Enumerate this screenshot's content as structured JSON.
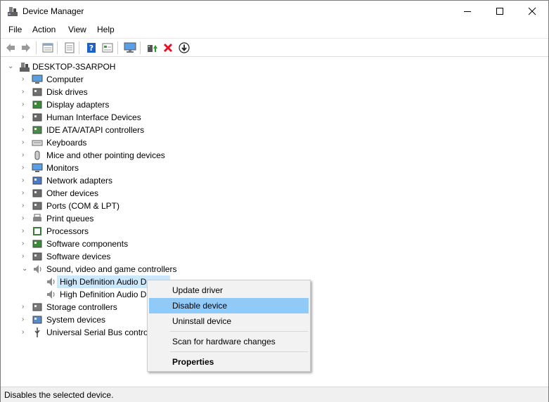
{
  "window": {
    "title": "Device Manager",
    "controls": {
      "minimize": "minimize",
      "maximize": "maximize",
      "close": "close"
    }
  },
  "menu": [
    "File",
    "Action",
    "View",
    "Help"
  ],
  "toolbar": {
    "buttons": [
      "back",
      "forward",
      "properties-pane",
      "view-mode",
      "help",
      "show-hidden",
      "computer-display",
      "update-driver",
      "uninstall",
      "disable"
    ]
  },
  "tree": {
    "root": "DESKTOP-3SARPOH",
    "categories": [
      {
        "label": "Computer",
        "icon": "computer-icon"
      },
      {
        "label": "Disk drives",
        "icon": "disk-drive-icon"
      },
      {
        "label": "Display adapters",
        "icon": "display-adapter-icon"
      },
      {
        "label": "Human Interface Devices",
        "icon": "hid-icon"
      },
      {
        "label": "IDE ATA/ATAPI controllers",
        "icon": "ide-controller-icon"
      },
      {
        "label": "Keyboards",
        "icon": "keyboard-icon"
      },
      {
        "label": "Mice and other pointing devices",
        "icon": "mouse-icon"
      },
      {
        "label": "Monitors",
        "icon": "monitor-icon"
      },
      {
        "label": "Network adapters",
        "icon": "network-adapter-icon"
      },
      {
        "label": "Other devices",
        "icon": "other-devices-icon"
      },
      {
        "label": "Ports (COM & LPT)",
        "icon": "ports-icon"
      },
      {
        "label": "Print queues",
        "icon": "printer-icon"
      },
      {
        "label": "Processors",
        "icon": "processor-icon"
      },
      {
        "label": "Software components",
        "icon": "software-component-icon"
      },
      {
        "label": "Software devices",
        "icon": "software-device-icon"
      },
      {
        "label": "Sound, video and game controllers",
        "icon": "speaker-icon",
        "expanded": true
      }
    ],
    "sound_children": [
      "High Definition Audio De",
      "High Definition Audio D"
    ],
    "after": [
      {
        "label": "Storage controllers",
        "icon": "storage-controller-icon"
      },
      {
        "label": "System devices",
        "icon": "system-device-icon"
      },
      {
        "label": "Universal Serial Bus control",
        "icon": "usb-icon"
      }
    ]
  },
  "context_menu": {
    "update": "Update driver",
    "disable": "Disable device",
    "uninstall": "Uninstall device",
    "scan": "Scan for hardware changes",
    "properties": "Properties"
  },
  "status": "Disables the selected device.",
  "colors": {
    "selection": "#cce8ff",
    "menu_highlight": "#91c9f7",
    "uninstall_red": "#e81123",
    "help_blue": "#1e62c8"
  }
}
